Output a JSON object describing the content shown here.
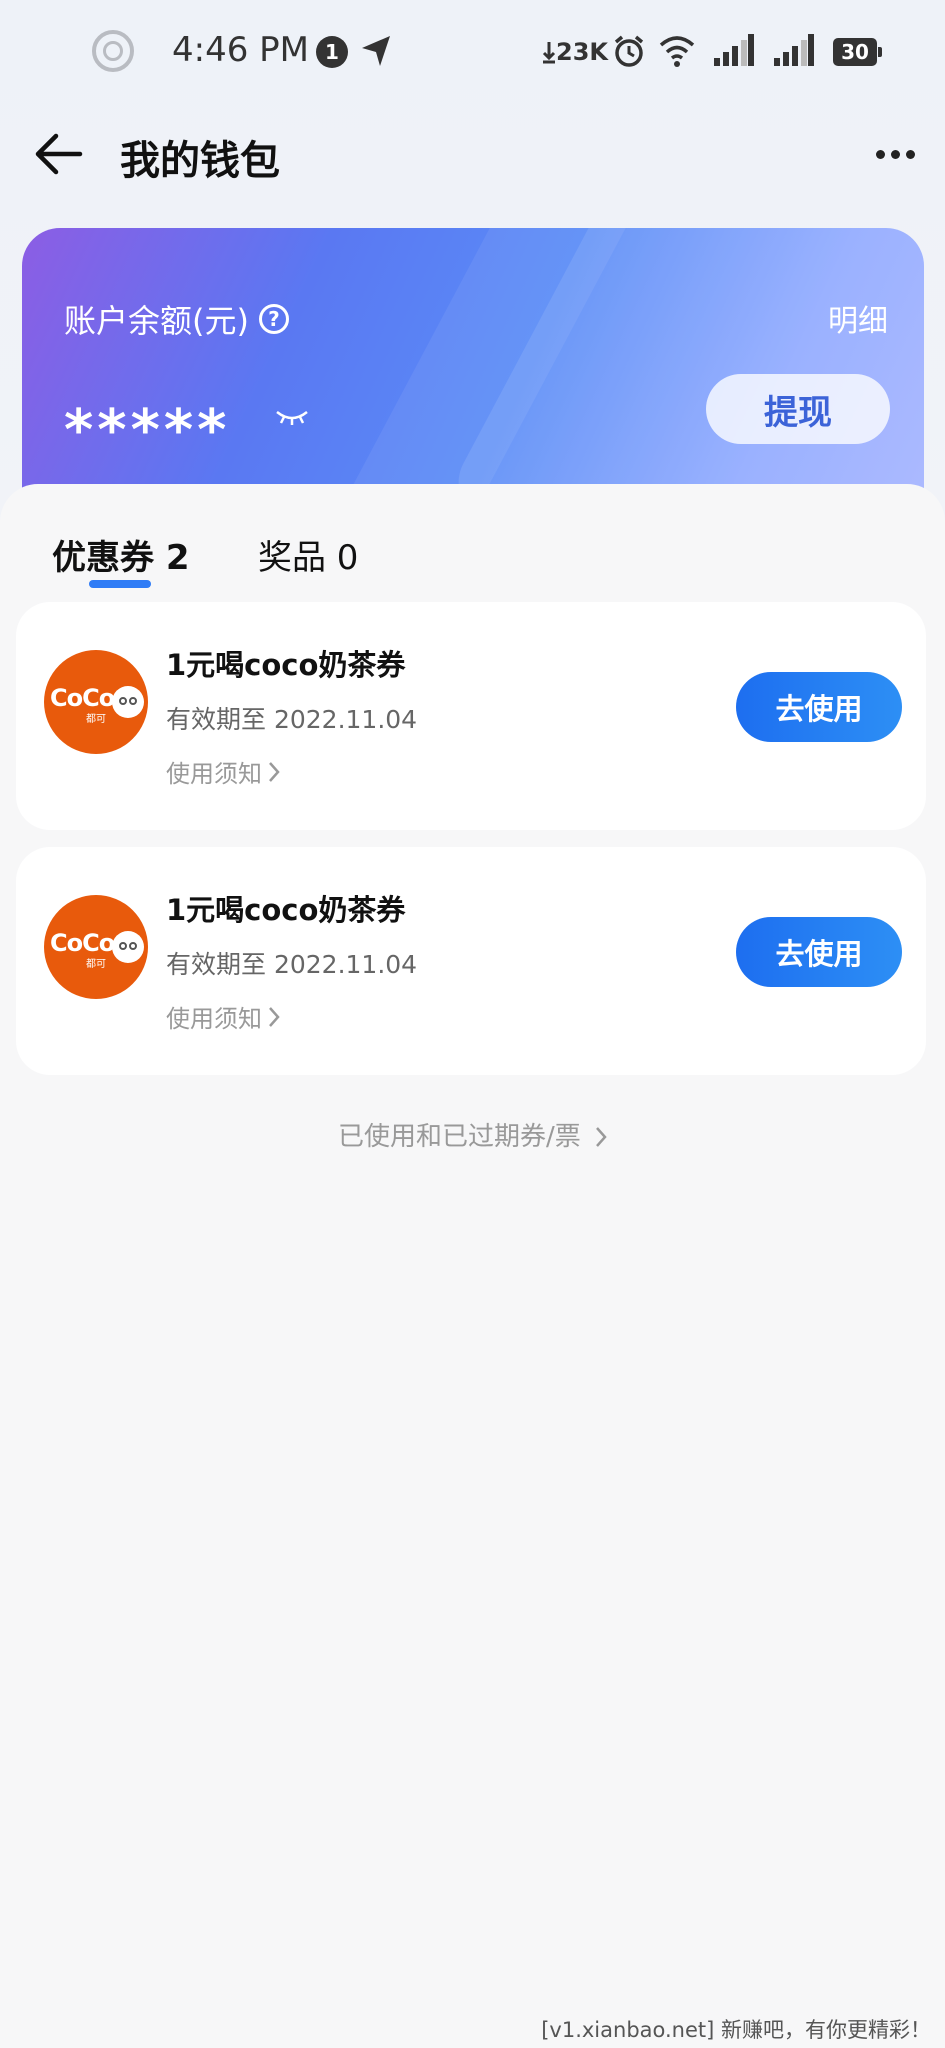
{
  "status_bar": {
    "time": "4:46 PM",
    "notification_count": "1",
    "net_speed": "23K",
    "battery": "30"
  },
  "header": {
    "title": "我的钱包"
  },
  "balance_card": {
    "label": "账户余额(元)",
    "detail_label": "明细",
    "masked_value": "*****",
    "withdraw_label": "提现"
  },
  "tabs": [
    {
      "label": "优惠券 2",
      "active": true
    },
    {
      "label": "奖品 0",
      "active": false
    }
  ],
  "coupons": [
    {
      "brand": "CoCo",
      "brand_sub": "都可",
      "title": "1元喝coco奶茶券",
      "expiry": "有效期至 2022.11.04",
      "notice": "使用须知",
      "action": "去使用"
    },
    {
      "brand": "CoCo",
      "brand_sub": "都可",
      "title": "1元喝coco奶茶券",
      "expiry": "有效期至 2022.11.04",
      "notice": "使用须知",
      "action": "去使用"
    }
  ],
  "history_link": "已使用和已过期券/票",
  "watermark": "[v1.xianbao.net] 新赚吧，有你更精彩！",
  "colors": {
    "accent": "#2f7cf6",
    "brand_orange": "#e85a0c"
  }
}
